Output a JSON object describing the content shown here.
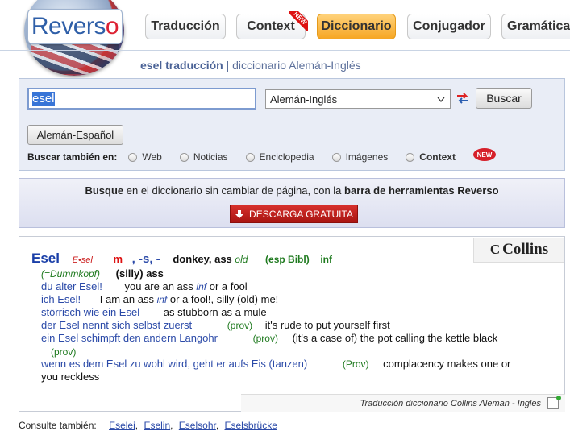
{
  "logo": {
    "text": "Revers",
    "o": "o"
  },
  "tabs": [
    {
      "label": "Traducción"
    },
    {
      "label": "Context",
      "badge": "NEW"
    },
    {
      "label": "Diccionario",
      "active": true
    },
    {
      "label": "Conjugador"
    },
    {
      "label": "Gramática"
    }
  ],
  "subtitle": {
    "bold": "esel traducción",
    "rest": " | diccionario Alemán-Inglés"
  },
  "search": {
    "value": "esel",
    "language": "Alemán-Inglés",
    "search_button": "Buscar",
    "alt_button": "Alemán-Español",
    "also_label": "Buscar también en:",
    "options": [
      "Web",
      "Noticias",
      "Enciclopedia",
      "Imágenes",
      "Context"
    ],
    "new_badge": "NEW"
  },
  "promo": {
    "bold1": "Busque",
    "mid": " en el diccionario sin cambiar de página, con la ",
    "bold2": "barra de herramientas Reverso",
    "button": "DESCARGA GRATUITA"
  },
  "entry": {
    "brand": "Collins",
    "headword": "Esel",
    "gram": "E•sel",
    "gender": "m",
    "inflection": ", -s, -",
    "main_translation": "donkey, ass",
    "old": "old",
    "esp_bibl": "(esp Bibl)",
    "inf": "inf",
    "dummkopf": "(=Dummkopf)",
    "silly": "(silly) ass",
    "examples": [
      {
        "de": "du alter Esel!",
        "en": "you are an ass",
        "inf": "inf",
        "en2": "or a fool"
      },
      {
        "de": "ich Esel!",
        "en": "I am an ass",
        "inf": "inf",
        "en2": "or a fool!, silly (old) me!"
      },
      {
        "de": "störrisch wie ein Esel",
        "en": "as stubborn as a mule"
      },
      {
        "de": "der Esel nennt sich selbst zuerst",
        "prov": "(prov)",
        "en": "it's rude to put yourself first"
      },
      {
        "de": "ein Esel schimpft den andern Langohr",
        "prov": "(prov)",
        "en": "(it's a case of) the pot calling the kettle black",
        "prov2": "(prov)"
      },
      {
        "de": "wenn es dem Esel zu wohl wird, geht er aufs Eis (tanzen)",
        "prov": "(Prov)",
        "en": "complacency makes one or",
        "en2": "you reckless"
      }
    ],
    "source": "Traducción diccionario Collins Aleman - Ingles"
  },
  "consulte": {
    "label": "Consulte también:",
    "links": [
      "Eselei",
      "Eselin",
      "Eselsohr",
      "Eselsbrücke"
    ]
  }
}
